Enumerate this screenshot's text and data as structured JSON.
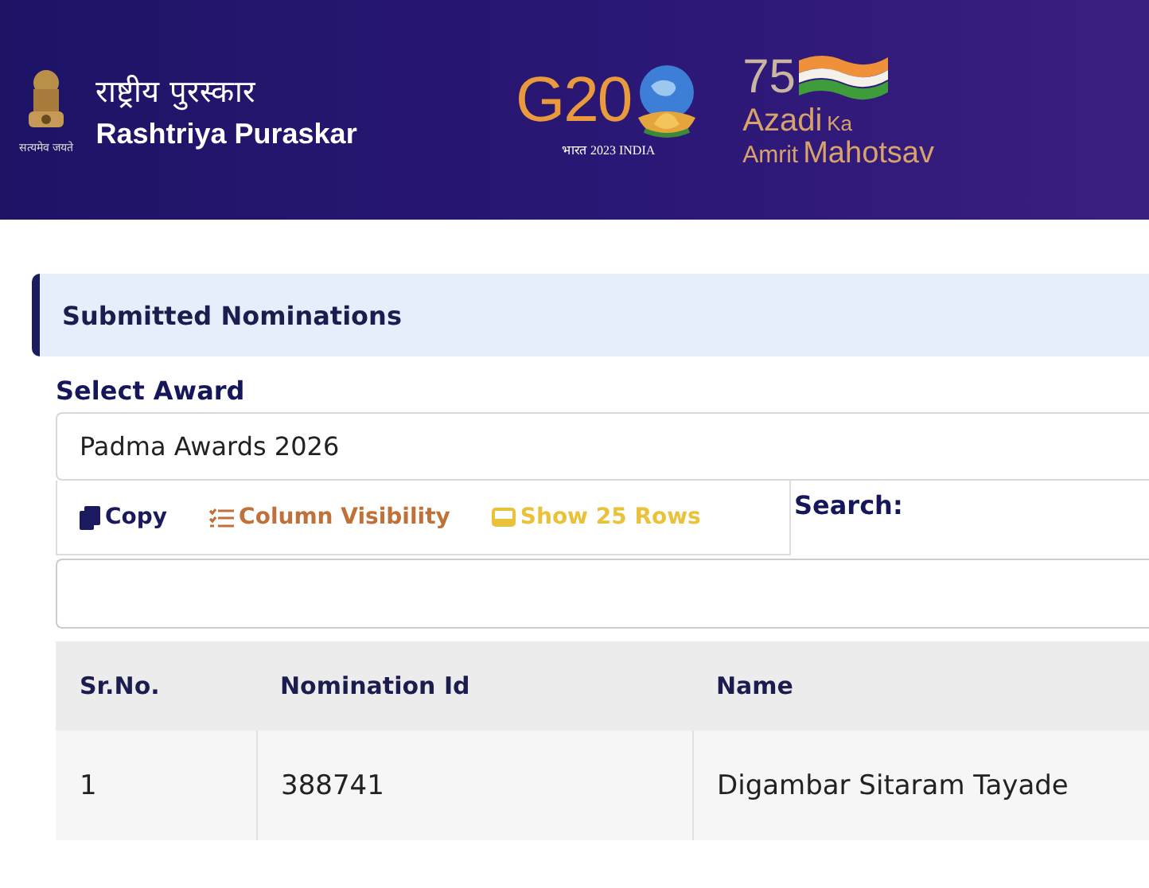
{
  "header": {
    "emblem_motto": "सत्यमेव जयते",
    "title_hindi": "राष्ट्रीय पुरस्कार",
    "title_english": "Rashtriya Puraskar",
    "g20": {
      "mark": "G20",
      "caption": "भारत 2023 INDIA"
    },
    "amrit": {
      "number": "75",
      "line1": "Azadi",
      "ka": "Ka",
      "line2a": "Amrit",
      "line2b": "Mahotsav"
    }
  },
  "card": {
    "title": "Submitted Nominations"
  },
  "award": {
    "label": "Select Award",
    "value": "Padma Awards 2026"
  },
  "toolbar": [
    {
      "kind": "copy",
      "label": "Copy"
    },
    {
      "kind": "columns",
      "label": "Column Visibility"
    },
    {
      "kind": "rows",
      "label": "Show 25 Rows"
    }
  ],
  "search": {
    "label": "Search:"
  },
  "table": {
    "columns": [
      "Sr.No.",
      "Nomination Id",
      "Name"
    ],
    "rows": [
      [
        "1",
        "388741",
        "Digambar Sitaram Tayade"
      ]
    ]
  }
}
